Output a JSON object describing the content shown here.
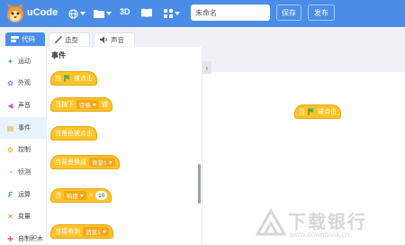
{
  "header": {
    "brand": "uCode",
    "view_3d": "3D",
    "project_name_placeholder": "未命名",
    "save_label": "保存",
    "publish_label": "发布"
  },
  "tabs": [
    {
      "label": "代码"
    },
    {
      "label": "造型"
    },
    {
      "label": "声音"
    }
  ],
  "categories": [
    {
      "label": "运动",
      "icon": "motion-icon",
      "color": "#4a8de8"
    },
    {
      "label": "外观",
      "icon": "looks-icon",
      "color": "#9b6bff"
    },
    {
      "label": "声音",
      "icon": "sound-icon",
      "color": "#c45fd6"
    },
    {
      "label": "事件",
      "icon": "events-icon",
      "color": "#f0a91a"
    },
    {
      "label": "控制",
      "icon": "control-icon",
      "color": "#f0a91a"
    },
    {
      "label": "侦测",
      "icon": "sensing-icon",
      "color": "#36b7e6"
    },
    {
      "label": "运算",
      "icon": "operators-icon",
      "color": "#4caf50"
    },
    {
      "label": "变量",
      "icon": "variables-icon",
      "color": "#f07a1a"
    },
    {
      "label": "自制积木",
      "icon": "custom-blocks-icon",
      "color": "#e85a7a"
    }
  ],
  "palette": {
    "title": "事件",
    "blocks": {
      "flag_prefix": "当",
      "flag_suffix": "被点击",
      "key_prefix": "当按下",
      "key_value": "空格",
      "key_suffix": "键",
      "sprite_clicked": "当角色被点击",
      "backdrop_prefix": "当背景换成",
      "backdrop_value": "背景1",
      "gt_prefix": "当",
      "gt_value": "响度",
      "gt_op": ">",
      "gt_number": "10",
      "broadcast_prefix": "当接收到",
      "broadcast_value": "消息1"
    }
  },
  "workspace": {
    "block_prefix": "当",
    "block_suffix": "被点击"
  },
  "watermark": {
    "text": "下载银行",
    "url": "www.downbank.cn"
  }
}
